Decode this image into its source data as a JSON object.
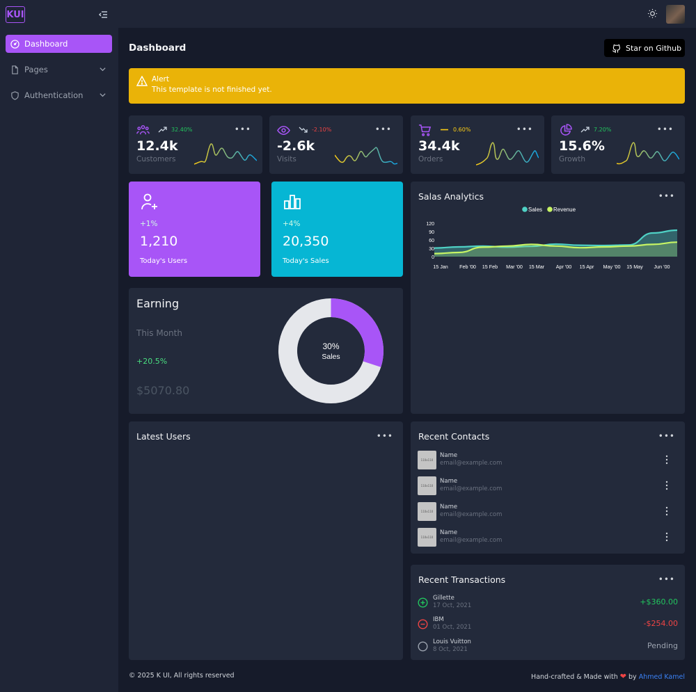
{
  "brand": {
    "logo_text": "KUI"
  },
  "sidebar": {
    "items": [
      {
        "label": "Dashboard",
        "icon": "gauge-icon"
      },
      {
        "label": "Pages",
        "icon": "file-icon"
      },
      {
        "label": "Authentication",
        "icon": "shield-icon"
      }
    ]
  },
  "header": {
    "title": "Dashboard",
    "github_label": "Star on Github"
  },
  "alert": {
    "title": "Alert",
    "message": "This template is not finished yet.",
    "color": "#eab308"
  },
  "stats": [
    {
      "value": "12.4k",
      "label": "Customers",
      "change": "32.40%",
      "trend": "up",
      "icon": "users-icon"
    },
    {
      "value": "-2.6k",
      "label": "Visits",
      "change": "-2.10%",
      "trend": "down",
      "icon": "eye-icon"
    },
    {
      "value": "34.4k",
      "label": "Orders",
      "change": "0.60%",
      "trend": "flat",
      "icon": "cart-icon"
    },
    {
      "value": "15.6%",
      "label": "Growth",
      "change": "7.20%",
      "trend": "up",
      "icon": "pie-icon"
    }
  ],
  "users_card": {
    "change": "+1%",
    "value": "1,210",
    "label": "Today's Users",
    "color": "#a855f7"
  },
  "sales_card": {
    "change": "+4%",
    "value": "20,350",
    "label": "Today's Sales",
    "color": "#06b6d4"
  },
  "analytics": {
    "title": "Salas Analytics"
  },
  "earning": {
    "title": "Earning",
    "period": "This Month",
    "change": "+20.5%",
    "amount": "$5070.80",
    "percent_label": "30%",
    "percent_caption": "Sales",
    "percent": 30
  },
  "latest_users": {
    "title": "Latest Users"
  },
  "contacts": {
    "title": "Recent Contacts",
    "placeholder": "110x110",
    "items": [
      {
        "name": "Name",
        "email": "email@example.com"
      },
      {
        "name": "Name",
        "email": "email@example.com"
      },
      {
        "name": "Name",
        "email": "email@example.com"
      },
      {
        "name": "Name",
        "email": "email@example.com"
      }
    ]
  },
  "transactions": {
    "title": "Recent Transactions",
    "items": [
      {
        "name": "Gillette",
        "date": "17 Oct, 2021",
        "amount": "+$360.00",
        "status": "income"
      },
      {
        "name": "IBM",
        "date": "01 Oct, 2021",
        "amount": "-$254.00",
        "status": "expense"
      },
      {
        "name": "Louis Vuitton",
        "date": "8 Oct, 2021",
        "amount": "Pending",
        "status": "pending"
      }
    ]
  },
  "footer": {
    "copyright": "© 2025 K UI, All rights reserved",
    "credit": "Hand-crafted & Made with",
    "heart": "❤",
    "by": "by",
    "author": "Ahmed Kamel"
  },
  "chart_data": {
    "type": "area",
    "legend_position": "top-center",
    "x": [
      "15 Jan",
      "Feb '00",
      "15 Feb",
      "Mar '00",
      "15 Mar",
      "Apr '00",
      "15 Apr",
      "May '00",
      "15 May",
      "Jun '00"
    ],
    "yticks": [
      0,
      30,
      60,
      90,
      120
    ],
    "ylim": [
      0,
      120
    ],
    "series": [
      {
        "name": "Sales",
        "color": "#4fd1c5",
        "values": [
          31,
          35,
          38,
          34,
          37,
          45,
          41,
          40,
          42,
          85,
          95
        ]
      },
      {
        "name": "Revenue",
        "color": "#c7f464",
        "values": [
          11,
          15,
          34,
          38,
          44,
          38,
          32,
          35,
          38,
          44,
          52
        ]
      }
    ]
  }
}
